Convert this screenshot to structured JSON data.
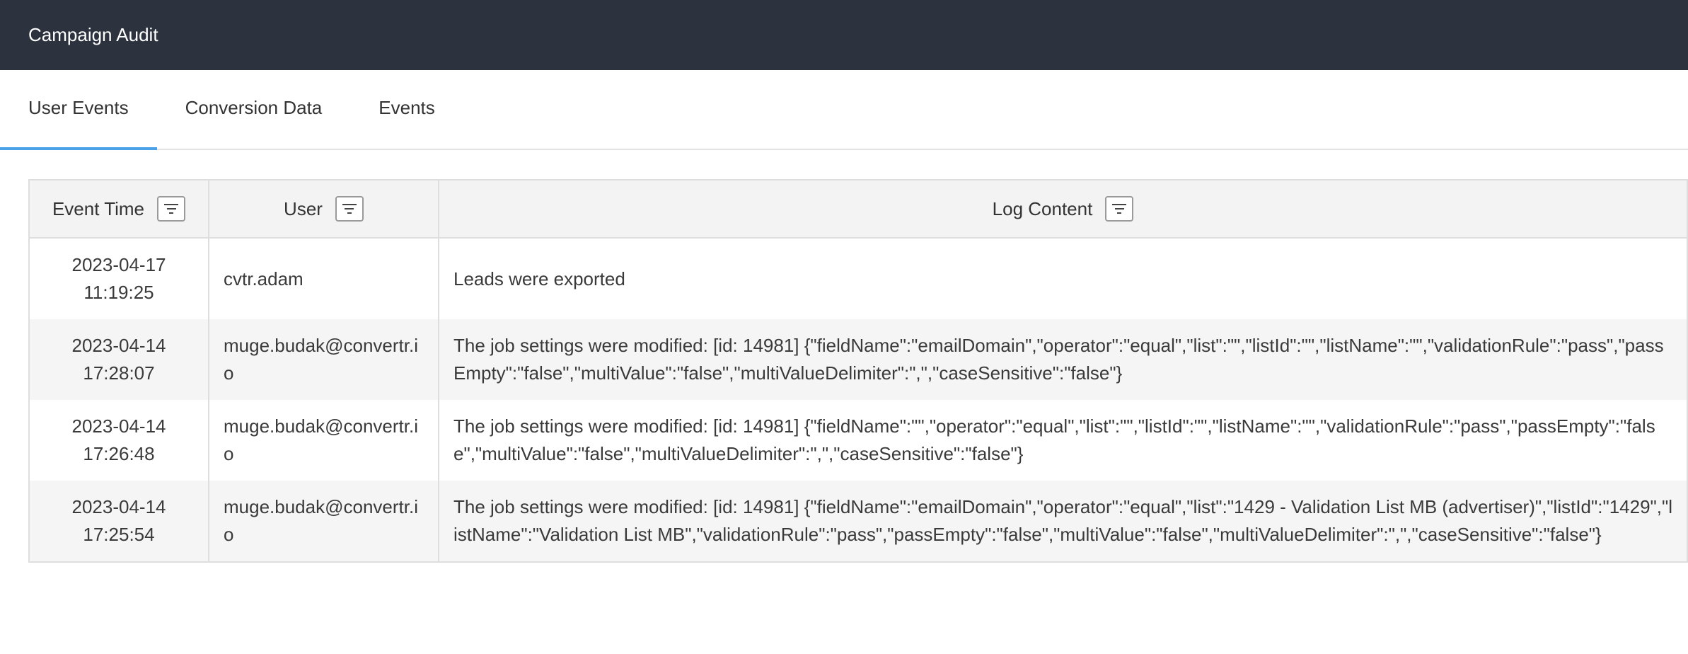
{
  "app": {
    "title": "Campaign Audit"
  },
  "tabs": [
    {
      "label": "User Events",
      "active": true
    },
    {
      "label": "Conversion Data",
      "active": false
    },
    {
      "label": "Events",
      "active": false
    }
  ],
  "table": {
    "columns": [
      {
        "label": "Event Time",
        "icon": "filter-icon"
      },
      {
        "label": "User",
        "icon": "filter-icon"
      },
      {
        "label": "Log Content",
        "icon": "filter-icon"
      }
    ],
    "rows": [
      {
        "time_date": "2023-04-17",
        "time_clock": "11:19:25",
        "user": "cvtr.adam",
        "log": "Leads were exported"
      },
      {
        "time_date": "2023-04-14",
        "time_clock": "17:28:07",
        "user": "muge.budak@convertr.io",
        "log": "The job settings were modified: [id: 14981] {\"fieldName\":\"emailDomain\",\"operator\":\"equal\",\"list\":\"\",\"listId\":\"\",\"listName\":\"\",\"validationRule\":\"pass\",\"passEmpty\":\"false\",\"multiValue\":\"false\",\"multiValueDelimiter\":\",\",\"caseSensitive\":\"false\"}"
      },
      {
        "time_date": "2023-04-14",
        "time_clock": "17:26:48",
        "user": "muge.budak@convertr.io",
        "log": "The job settings were modified: [id: 14981] {\"fieldName\":\"\",\"operator\":\"equal\",\"list\":\"\",\"listId\":\"\",\"listName\":\"\",\"validationRule\":\"pass\",\"passEmpty\":\"false\",\"multiValue\":\"false\",\"multiValueDelimiter\":\",\",\"caseSensitive\":\"false\"}"
      },
      {
        "time_date": "2023-04-14",
        "time_clock": "17:25:54",
        "user": "muge.budak@convertr.io",
        "log": "The job settings were modified: [id: 14981] {\"fieldName\":\"emailDomain\",\"operator\":\"equal\",\"list\":\"1429 - Validation List MB (advertiser)\",\"listId\":\"1429\",\"listName\":\"Validation List MB\",\"validationRule\":\"pass\",\"passEmpty\":\"false\",\"multiValue\":\"false\",\"multiValueDelimiter\":\",\",\"caseSensitive\":\"false\"}"
      }
    ]
  },
  "colors": {
    "topbar": "#2c333f",
    "tab_indicator": "#4aa1e8",
    "header_bg": "#f3f3f3",
    "alt_row_bg": "#f5f5f5"
  }
}
